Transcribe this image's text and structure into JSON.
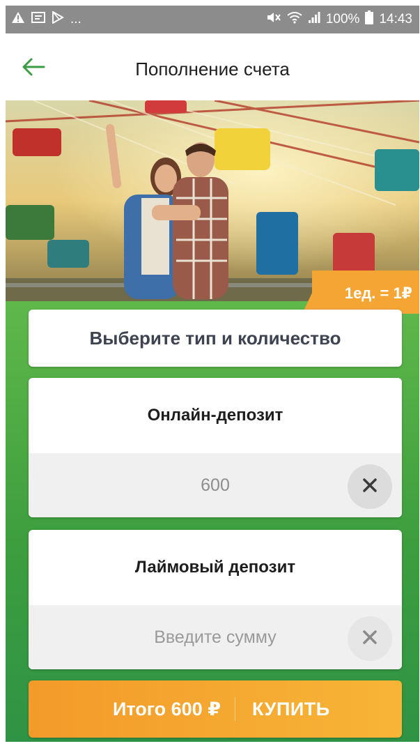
{
  "status_bar": {
    "left_icons": [
      "alert-triangle-icon",
      "message-icon",
      "play-store-icon"
    ],
    "more": "...",
    "battery": "100%",
    "time": "14:43"
  },
  "app_bar": {
    "back_icon": "arrow-left-icon",
    "title": "Пополнение счета"
  },
  "hero": {
    "price_tag": "1ед. = 1₽"
  },
  "main": {
    "choose_label": "Выберите тип и количество",
    "online_deposit": {
      "title": "Онлайн-депозит",
      "value": "600",
      "clear_icon": "close-icon"
    },
    "lime_deposit": {
      "title": "Лаймовый депозит",
      "value": "",
      "placeholder": "Введите сумму",
      "clear_icon": "close-icon"
    }
  },
  "buy_bar": {
    "total": "Итого 600 ₽",
    "action": "КУПИТЬ"
  },
  "colors": {
    "accent_green": "#3d9e3e",
    "accent_orange": "#f39a2b",
    "status_bar": "#8c8c8c"
  }
}
